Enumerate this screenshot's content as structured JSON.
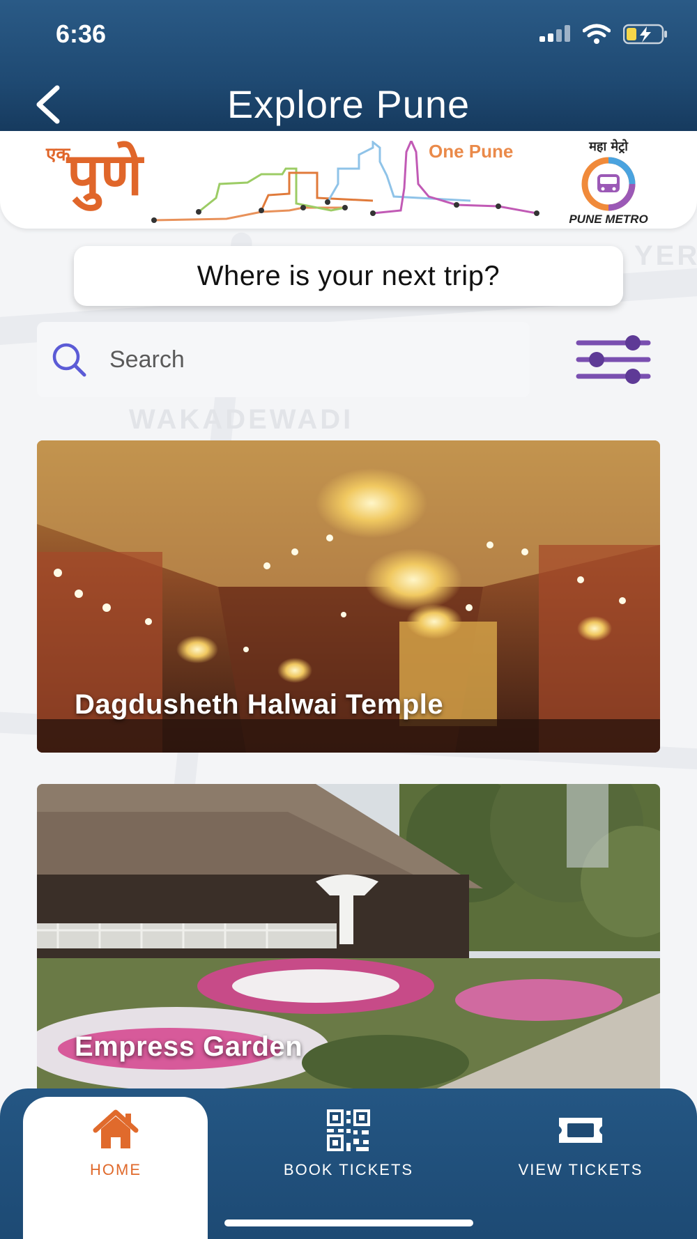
{
  "status_bar": {
    "time": "6:36"
  },
  "header": {
    "title": "Explore Pune"
  },
  "banner": {
    "ek": "एक",
    "pune": "पुणे",
    "one_pune": "One Pune",
    "maha_metro": "महा मेट्रो",
    "pune_metro": "PUNE METRO"
  },
  "trip_prompt": "Where is your next trip?",
  "search": {
    "placeholder": "Search"
  },
  "cards": [
    {
      "title": "Dagdusheth Halwai Temple"
    },
    {
      "title": "Empress Garden"
    }
  ],
  "bottom_nav": {
    "items": [
      {
        "label": "HOME",
        "icon": "home-icon",
        "active": true
      },
      {
        "label": "BOOK TICKETS",
        "icon": "qr-code-icon",
        "active": false
      },
      {
        "label": "VIEW TICKETS",
        "icon": "ticket-icon",
        "active": false
      }
    ]
  },
  "colors": {
    "header_blue": "#1f4a73",
    "accent_orange": "#e06a2c",
    "filter_purple": "#7a4fb0"
  }
}
